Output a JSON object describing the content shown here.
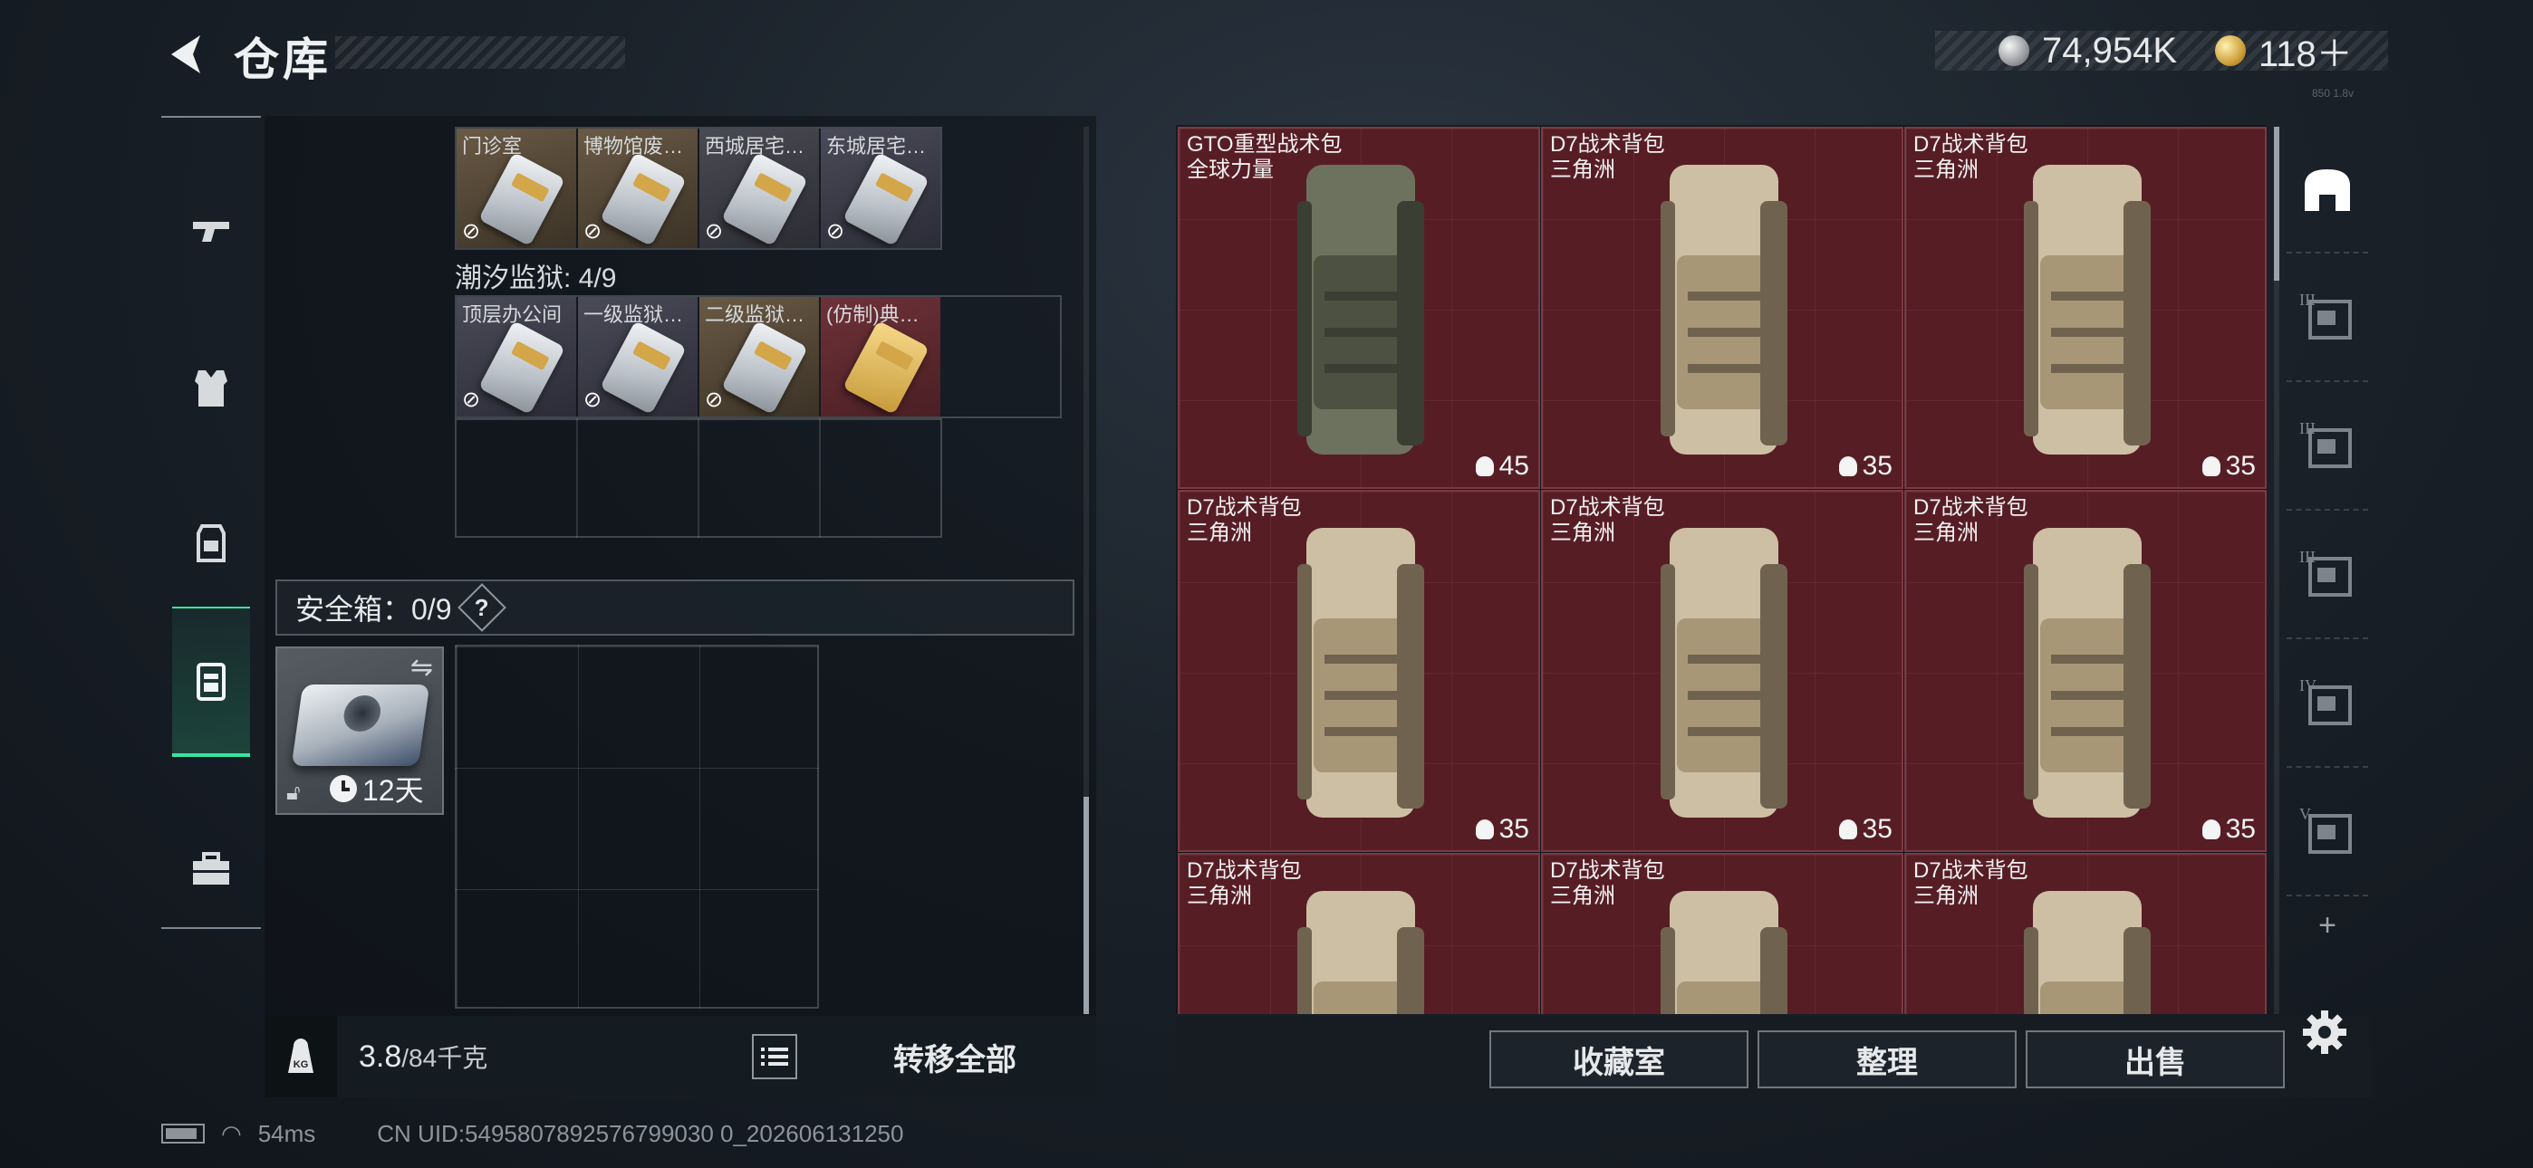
{
  "header": {
    "title": "仓库",
    "currency": [
      {
        "name": "silver-coin",
        "value": "74,954K"
      },
      {
        "name": "gold-coin",
        "value": "118＋"
      }
    ]
  },
  "corner_text": "850 1.8v",
  "left_nav": [
    "pistol-icon",
    "armor-vest-icon",
    "backpack-icon",
    "container-icon",
    "toolbox-icon"
  ],
  "key_rows": [
    {
      "items": [
        {
          "label": "门诊室"
        },
        {
          "label": "博物馆废…"
        },
        {
          "label": "西城居宅…"
        },
        {
          "label": "东城居宅…"
        }
      ]
    },
    {
      "section": "潮汐监狱: 4/9",
      "items": [
        {
          "label": "顶层办公间"
        },
        {
          "label": "一级监狱…"
        },
        {
          "label": "二级监狱…"
        },
        {
          "label": "(仿制)典…"
        }
      ]
    }
  ],
  "safebox": {
    "title": "安全箱：0/9",
    "help": "?",
    "timer": "12天"
  },
  "footer_left": {
    "weight_current": "3.8",
    "weight_max": "/84千克",
    "transfer_all": "转移全部"
  },
  "stash_items": [
    {
      "name": "GTO重型战术包",
      "brand": "全球力量",
      "capacity": "45",
      "color": "olive"
    },
    {
      "name": "D7战术背包",
      "brand": "三角洲",
      "capacity": "35",
      "color": "tan"
    },
    {
      "name": "D7战术背包",
      "brand": "三角洲",
      "capacity": "35",
      "color": "tan"
    },
    {
      "name": "D7战术背包",
      "brand": "三角洲",
      "capacity": "35",
      "color": "tan"
    },
    {
      "name": "D7战术背包",
      "brand": "三角洲",
      "capacity": "35",
      "color": "tan"
    },
    {
      "name": "D7战术背包",
      "brand": "三角洲",
      "capacity": "35",
      "color": "tan"
    },
    {
      "name": "D7战术背包",
      "brand": "三角洲",
      "capacity": "",
      "color": "tan"
    },
    {
      "name": "D7战术背包",
      "brand": "三角洲",
      "capacity": "",
      "color": "tan"
    },
    {
      "name": "D7战术背包",
      "brand": "三角洲",
      "capacity": "",
      "color": "tan"
    }
  ],
  "right_nav": [
    {
      "icon": "home-stash-icon",
      "label": ""
    },
    {
      "icon": "stash-tab-icon",
      "label": "III"
    },
    {
      "icon": "stash-tab-icon",
      "label": "III"
    },
    {
      "icon": "stash-tab-icon",
      "label": "III"
    },
    {
      "icon": "stash-tab-icon",
      "label": "IV"
    },
    {
      "icon": "stash-tab-icon",
      "label": "V"
    },
    {
      "icon": "add-tab-icon",
      "label": "+"
    }
  ],
  "footer_right": {
    "collection": "收藏室",
    "sort": "整理",
    "sell": "出售"
  },
  "status": {
    "ping": "54ms",
    "uid": "CN UID:5495807892576799030 0_202606131250"
  },
  "colors": {
    "accent_green": "#39e3a1",
    "stash_bg": "#571d25"
  }
}
